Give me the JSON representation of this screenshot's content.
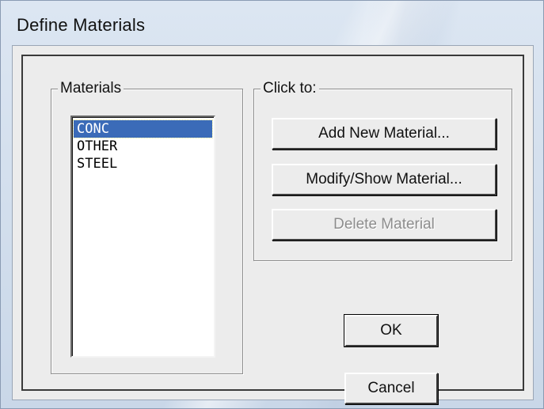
{
  "window": {
    "title": "Define Materials"
  },
  "materials_group": {
    "label": "Materials",
    "items": [
      {
        "label": "CONC",
        "selected": true
      },
      {
        "label": "OTHER",
        "selected": false
      },
      {
        "label": "STEEL",
        "selected": false
      }
    ]
  },
  "actions_group": {
    "label": "Click to:",
    "add_label": "Add New Material...",
    "modify_label": "Modify/Show Material...",
    "delete_label": "Delete Material"
  },
  "dialog_buttons": {
    "ok_label": "OK",
    "cancel_label": "Cancel"
  },
  "colors": {
    "selection": "#3b6bb8",
    "dialog_bg": "#ececec"
  }
}
